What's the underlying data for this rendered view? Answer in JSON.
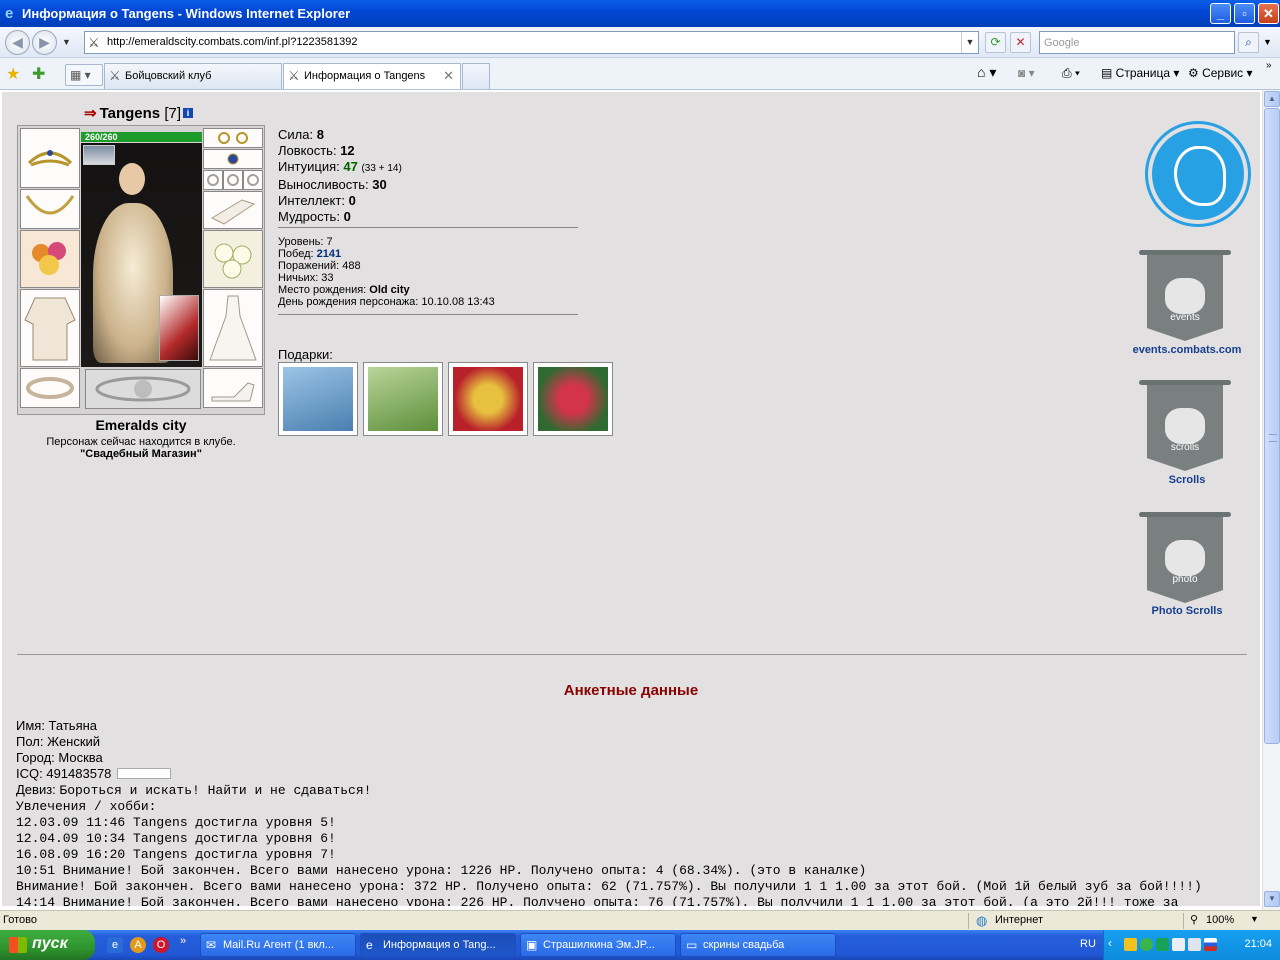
{
  "window": {
    "title": "Информация о Tangens - Windows Internet Explorer"
  },
  "nav": {
    "url": "http://emeraldscity.combats.com/inf.pl?1223581392",
    "search_placeholder": "Google"
  },
  "tabs": [
    {
      "label": "Бойцовский клуб"
    },
    {
      "label": "Информация о Tangens"
    }
  ],
  "toolbar": {
    "page_label": "Страница",
    "tools_label": "Сервис"
  },
  "character": {
    "nick": "Tangens",
    "level_tag": "[7]",
    "hp": "260/260",
    "city": "Emeralds city",
    "location_text": "Персонаж сейчас находится в клубе.",
    "location_name": "\"Свадебный Магазин\""
  },
  "stats": {
    "strength_label": "Сила:",
    "strength": "8",
    "agility_label": "Ловкость:",
    "agility": "12",
    "intuition_label": "Интуиция:",
    "intuition": "47",
    "intuition_extra": "(33 + 14)",
    "endurance_label": "Выносливость:",
    "endurance": "30",
    "intellect_label": "Интеллект:",
    "intellect": "0",
    "wisdom_label": "Мудрость:",
    "wisdom": "0"
  },
  "info": {
    "level": "Уровень: 7",
    "wins_label": "Побед:",
    "wins": "2141",
    "losses": "Поражений: 488",
    "draws": "Ничьих: 33",
    "birthplace_label": "Место рождения:",
    "birthplace": "Old city",
    "birthday": "День рождения персонажа: 10.10.08 13:43"
  },
  "gifts": {
    "label": "Подарки:",
    "colors": [
      "#4a7fb0",
      "#5d8f3a",
      "#b8202a",
      "#2f6a32"
    ]
  },
  "side": {
    "events_link": "events.combats.com",
    "events_banner": "events",
    "scrolls_link": "Scrolls",
    "scrolls_banner": "scrolls",
    "photo_link": "Photo Scrolls",
    "photo_banner": "photo"
  },
  "profile": {
    "heading": "Анкетные данные",
    "name": "Имя: Татьяна",
    "gender": "Пол: Женский",
    "city": "Город: Москва",
    "icq": "ICQ: 491483578",
    "motto_label": "Девиз:",
    "motto": "Бороться и искать! Найти и не сдаваться!",
    "hobby": "Увлечения / хобби:",
    "lines": [
      "12.03.09 11:46 Tangens достигла уровня 5!",
      "12.04.09 10:34 Tangens достигла уровня 6!",
      "16.08.09 16:20 Tangens достигла уровня 7!",
      "10:51 Внимание! Бой закончен. Всего вами нанесено урона: 1226 HP. Получено опыта: 4 (68.34%). (это в каналке)",
      "Внимание! Бой закончен. Всего вами нанесено урона: 372 HP. Получено опыта: 62 (71.757%). Вы получили 1 1 1.00 за этот бой. (Мой 1й белый зуб за бой!!!!)",
      "14:14 Внимание! Бой закончен. Всего вами нанесено урона: 226 HP. Получено опыта: 76 (71.757%). Вы получили 1 1 1.00 за этот бой. (а это 2й!!! тоже за"
    ]
  },
  "status": {
    "left": "Готово",
    "zone": "Интернет",
    "zoom": "100%"
  },
  "taskbar": {
    "start": "пуск",
    "items": [
      "Mail.Ru Агент (1 вкл...",
      "Информация о Tang...",
      "Страшилкина Эм.JP...",
      "скрины свадьба"
    ],
    "lang": "RU",
    "clock": "21:04"
  }
}
